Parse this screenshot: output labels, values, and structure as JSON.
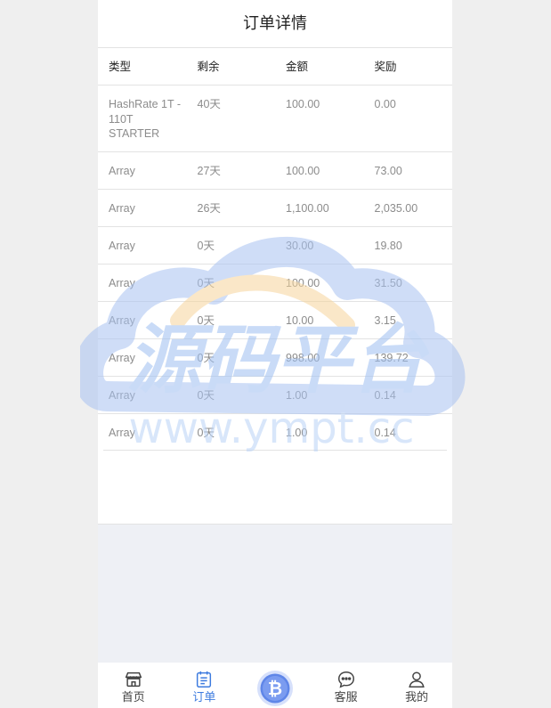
{
  "page": {
    "title": "订单详情"
  },
  "table": {
    "headers": [
      "类型",
      "剩余",
      "金额",
      "奖励"
    ],
    "rows": [
      [
        "HashRate 1T - 110T STARTER",
        "40天",
        "100.00",
        "0.00"
      ],
      [
        "Array",
        "27天",
        "100.00",
        "73.00"
      ],
      [
        "Array",
        "26天",
        "1,100.00",
        "2,035.00"
      ],
      [
        "Array",
        "0天",
        "30.00",
        "19.80"
      ],
      [
        "Array",
        "0天",
        "100.00",
        "31.50"
      ],
      [
        "Array",
        "0天",
        "10.00",
        "3.15"
      ],
      [
        "Array",
        "0天",
        "998.00",
        "139.72"
      ],
      [
        "Array",
        "0天",
        "1.00",
        "0.14"
      ],
      [
        "Array",
        "0天",
        "1.00",
        "0.14"
      ]
    ]
  },
  "watermark": {
    "title": "源码平台",
    "url": "www.ympt.cc"
  },
  "tabbar": {
    "items": [
      {
        "label": "首页",
        "icon": "store-icon"
      },
      {
        "label": "订单",
        "icon": "order-list-icon",
        "active": true
      },
      {
        "label": "",
        "icon": "bitcoin-icon"
      },
      {
        "label": "客服",
        "icon": "chat-bubble-icon"
      },
      {
        "label": "我的",
        "icon": "user-icon"
      }
    ]
  },
  "colors": {
    "accent": "#3d7bdf",
    "background": "#eef0f5",
    "card": "#ffffff"
  }
}
